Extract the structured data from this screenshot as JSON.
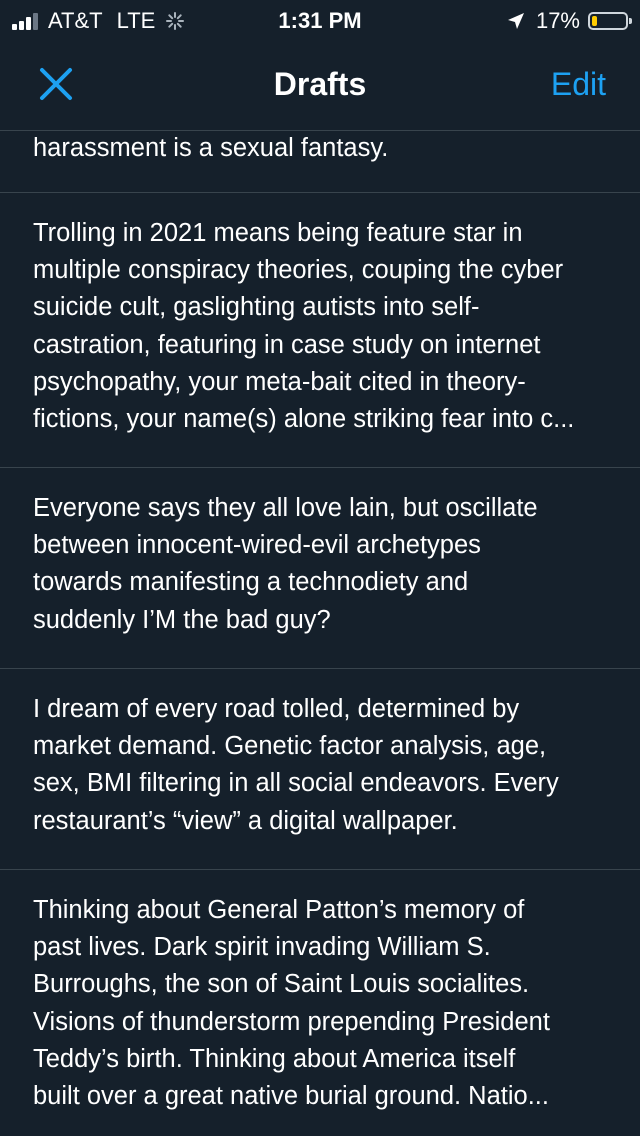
{
  "status_bar": {
    "carrier": "AT&T",
    "network": "LTE",
    "time": "1:31 PM",
    "battery_percent": "17%",
    "battery_level": 0.17,
    "signal_bars": 3,
    "battery_color": "#ffcc00"
  },
  "nav": {
    "close_icon": "close-icon",
    "title": "Drafts",
    "edit_label": "Edit",
    "accent_color": "#1da1f2"
  },
  "drafts": [
    {
      "lines": [
        "harassment is a sexual fantasy."
      ]
    },
    {
      "lines": [
        "Trolling in 2021 means being feature star in",
        "multiple conspiracy theories, couping the cyber",
        "suicide cult, gaslighting autists into self-",
        "castration, featuring in case study on internet",
        "psychopathy, your meta-bait cited in theory-",
        "fictions, your name(s) alone striking fear into c..."
      ]
    },
    {
      "lines": [
        "Everyone says they all love lain, but oscillate",
        "between innocent-wired-evil archetypes",
        "towards manifesting a technodiety and",
        "suddenly I’M the bad guy?"
      ]
    },
    {
      "lines": [
        "I dream of every road tolled, determined by",
        "market demand. Genetic factor analysis, age,",
        "sex, BMI filtering in all social endeavors. Every",
        "restaurant’s “view” a digital wallpaper."
      ]
    },
    {
      "lines": [
        "Thinking about General Patton’s memory of",
        "past lives. Dark spirit invading William S.",
        "Burroughs, the son of Saint Louis socialites.",
        "Visions of thunderstorm prepending President",
        "Teddy’s birth. Thinking about America itself",
        "built over a great native burial ground. Natio..."
      ]
    }
  ]
}
